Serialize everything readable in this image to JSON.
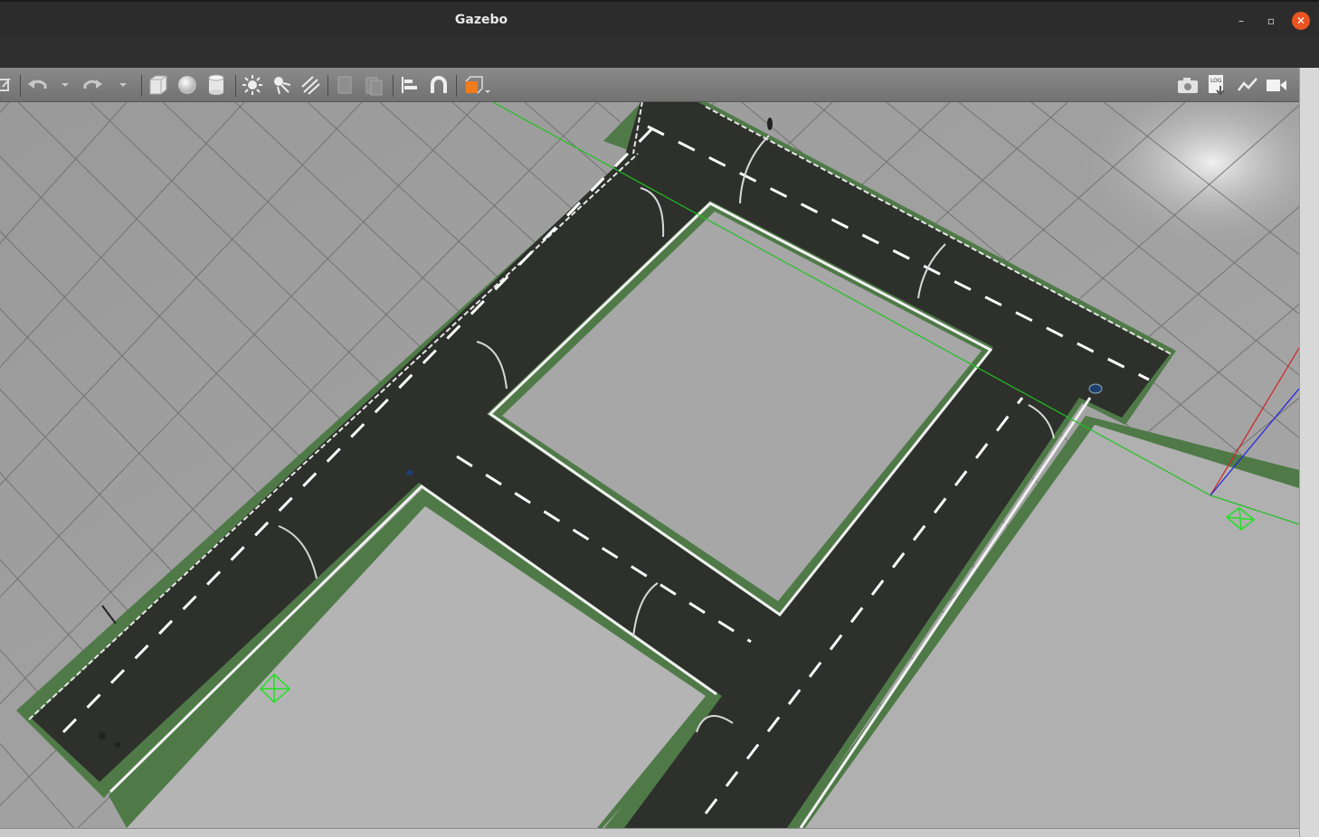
{
  "window": {
    "title": "Gazebo",
    "controls": {
      "minimize": "–",
      "maximize": "▫",
      "close": "✕"
    }
  },
  "toolbar": {
    "items": [
      "translate-mode-icon",
      "undo-icon",
      "undo-history-dropdown-icon",
      "redo-icon",
      "redo-history-dropdown-icon",
      "box-shape-icon",
      "sphere-shape-icon",
      "cylinder-shape-icon",
      "point-light-icon",
      "spot-light-icon",
      "directional-light-icon",
      "copy-icon",
      "paste-icon",
      "align-icon",
      "snap-icon",
      "view-angle-icon",
      "screenshot-icon",
      "log-icon",
      "plot-icon",
      "record-video-icon"
    ],
    "log_label": "LOG"
  },
  "scene": {
    "background_color": "#9c9c9c",
    "grid_color": "#6e6e6e",
    "road_color": "#2e302c",
    "sidewalk_color": "#4f7a48",
    "lane_marking_color": "#ffffff",
    "axis_colors": {
      "x": "#d02020",
      "y": "#20c020",
      "z": "#2020e0"
    }
  }
}
